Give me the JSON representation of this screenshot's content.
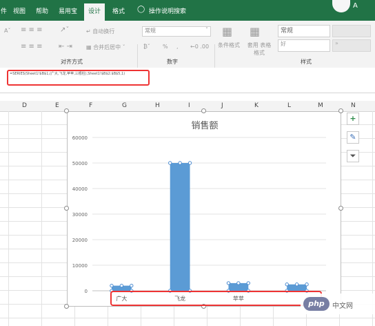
{
  "menu": {
    "tabs": [
      "件",
      "视图",
      "帮助",
      "易用宝",
      "设计",
      "格式"
    ],
    "active_tab": "设计",
    "tell_me": "操作说明搜索",
    "user_initial": "A"
  },
  "ribbon": {
    "wrap_text": "自动换行",
    "merge_center": "合并后居中",
    "number_format": "常规",
    "percent": "%",
    "comma": ",",
    "conditional_format": "条件格式",
    "format_as_table": "套用 表格格式",
    "style_normal": "常规",
    "style_good": "好",
    "groups": {
      "alignment": "对齐方式",
      "number": "数字",
      "styles": "样式"
    }
  },
  "formula_bar": {
    "formula": "=SERIES(Sheet1!$B$1,(广大,飞龙,苹苹,三根柱),Sheet1!$B$2:$B$5,1)"
  },
  "columns": [
    "D",
    "E",
    "F",
    "G",
    "H",
    "I",
    "J",
    "K",
    "L",
    "M",
    "N"
  ],
  "chart_data": {
    "type": "bar",
    "title": "销售额",
    "categories": [
      "广大",
      "飞龙",
      "苹苹",
      ""
    ],
    "values": [
      2000,
      50000,
      3000,
      2500
    ],
    "ylim": [
      0,
      60000
    ],
    "yticks": [
      0,
      10000,
      20000,
      30000,
      40000,
      50000,
      60000
    ],
    "bar_color": "#5b9bd5",
    "grid": true,
    "legend": "none"
  },
  "side_buttons": [
    "+",
    "✎",
    "⏷"
  ],
  "watermark": {
    "logo": "php",
    "text": "中文网"
  },
  "colors": {
    "menu_bar": "#217346",
    "highlight": "#ee3333",
    "bar": "#5b9bd5"
  }
}
